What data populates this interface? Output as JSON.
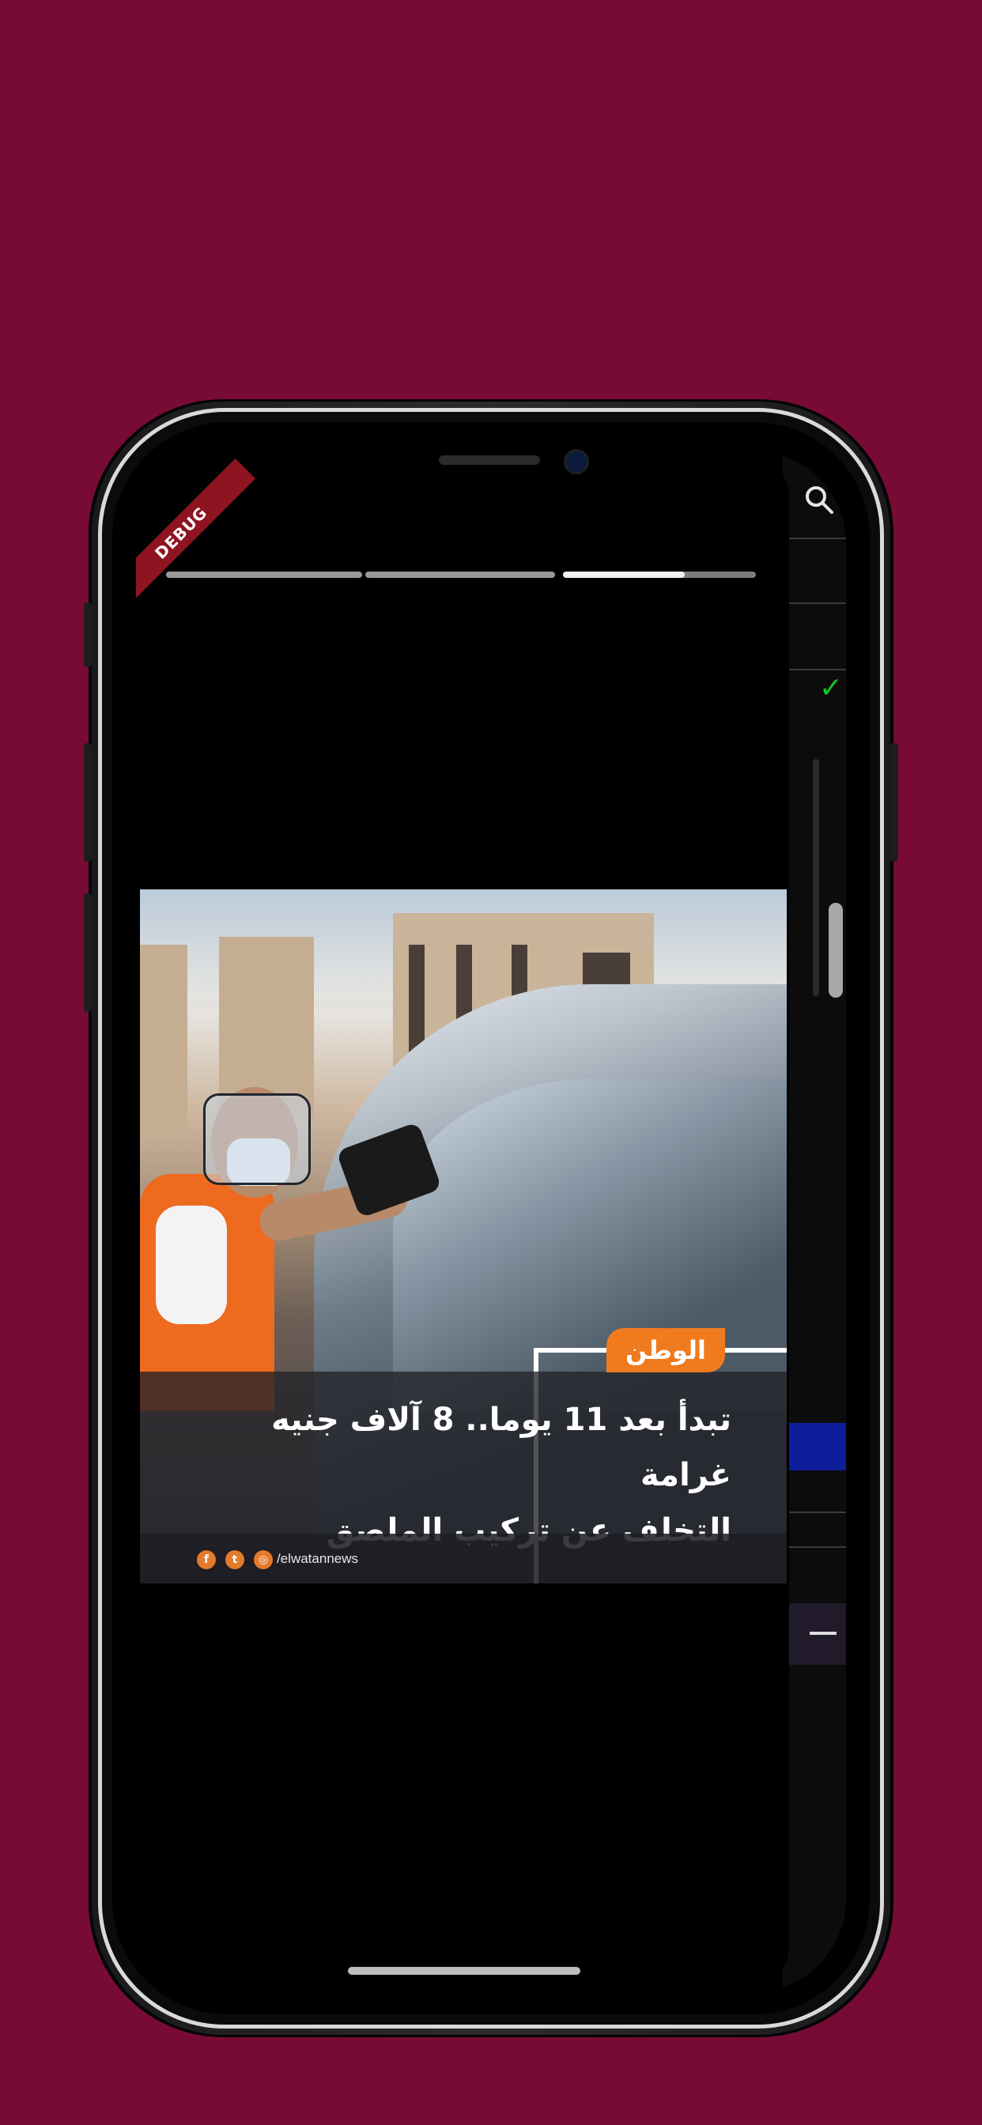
{
  "app": {
    "debug_banner": "DEBUG",
    "background_color": "#780b36"
  },
  "story": {
    "progress_segments": 3,
    "active_segment": 3,
    "active_segment_fill": 0.63
  },
  "news_card": {
    "logo_text": "الوطن",
    "headline_line1": "تبدأ بعد 11 يوما.. 8 آلاف جنيه غرامة",
    "headline_line2": "التخلف عن تركيب الملصق",
    "social_handle": "/elwatannews",
    "social_icons": [
      "facebook-icon",
      "twitter-icon",
      "instagram-icon"
    ]
  },
  "icons": {
    "search": "search-icon",
    "check": "check-icon"
  }
}
